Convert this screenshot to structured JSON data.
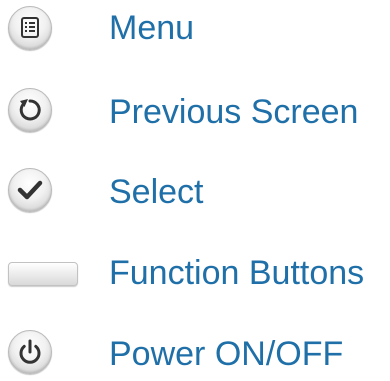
{
  "colors": {
    "label": "#1f6fa8",
    "icon_glyph": "#333333"
  },
  "legend": {
    "items": [
      {
        "icon": "menu-icon",
        "label": "Menu"
      },
      {
        "icon": "previous-screen-icon",
        "label": "Previous Screen"
      },
      {
        "icon": "checkmark-icon",
        "label": "Select"
      },
      {
        "icon": "function-button-icon",
        "label": "Function Buttons"
      },
      {
        "icon": "power-icon",
        "label": "Power ON/OFF"
      }
    ]
  }
}
